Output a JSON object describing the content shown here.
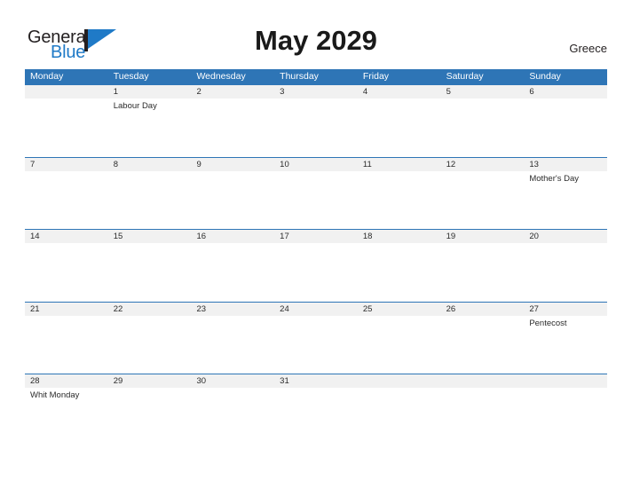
{
  "brand": {
    "name_part1": "General",
    "name_part2": "Blue",
    "colors": {
      "blue": "#1f7ac7",
      "dark": "#231f20"
    }
  },
  "header": {
    "title": "May 2029",
    "country": "Greece"
  },
  "calendar": {
    "accent_color": "#2e75b6",
    "band_color": "#f1f1f1",
    "weekdays": [
      "Monday",
      "Tuesday",
      "Wednesday",
      "Thursday",
      "Friday",
      "Saturday",
      "Sunday"
    ],
    "weeks": [
      [
        {
          "number": "",
          "events": []
        },
        {
          "number": "1",
          "events": [
            "Labour Day"
          ]
        },
        {
          "number": "2",
          "events": []
        },
        {
          "number": "3",
          "events": []
        },
        {
          "number": "4",
          "events": []
        },
        {
          "number": "5",
          "events": []
        },
        {
          "number": "6",
          "events": []
        }
      ],
      [
        {
          "number": "7",
          "events": []
        },
        {
          "number": "8",
          "events": []
        },
        {
          "number": "9",
          "events": []
        },
        {
          "number": "10",
          "events": []
        },
        {
          "number": "11",
          "events": []
        },
        {
          "number": "12",
          "events": []
        },
        {
          "number": "13",
          "events": [
            "Mother's Day"
          ]
        }
      ],
      [
        {
          "number": "14",
          "events": []
        },
        {
          "number": "15",
          "events": []
        },
        {
          "number": "16",
          "events": []
        },
        {
          "number": "17",
          "events": []
        },
        {
          "number": "18",
          "events": []
        },
        {
          "number": "19",
          "events": []
        },
        {
          "number": "20",
          "events": []
        }
      ],
      [
        {
          "number": "21",
          "events": []
        },
        {
          "number": "22",
          "events": []
        },
        {
          "number": "23",
          "events": []
        },
        {
          "number": "24",
          "events": []
        },
        {
          "number": "25",
          "events": []
        },
        {
          "number": "26",
          "events": []
        },
        {
          "number": "27",
          "events": [
            "Pentecost"
          ]
        }
      ],
      [
        {
          "number": "28",
          "events": [
            "Whit Monday"
          ]
        },
        {
          "number": "29",
          "events": []
        },
        {
          "number": "30",
          "events": []
        },
        {
          "number": "31",
          "events": []
        },
        {
          "number": "",
          "events": []
        },
        {
          "number": "",
          "events": []
        },
        {
          "number": "",
          "events": []
        }
      ]
    ]
  }
}
